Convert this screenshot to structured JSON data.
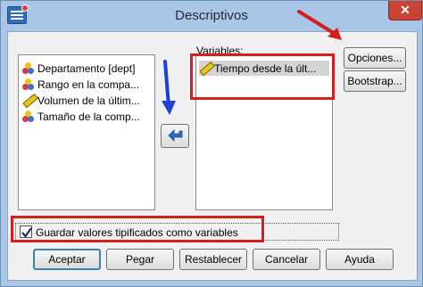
{
  "window": {
    "title": "Descriptivos",
    "close_glyph": "✕"
  },
  "source_list": {
    "items": [
      {
        "label": "Departamento [dept]",
        "icon": "nominal-icon"
      },
      {
        "label": "Rango en la compa...",
        "icon": "nominal-icon"
      },
      {
        "label": "Volumen de la últim...",
        "icon": "scale-icon"
      },
      {
        "label": "Tamaño de la comp...",
        "icon": "nominal-icon"
      }
    ]
  },
  "variables": {
    "label": "Variables:",
    "items": [
      {
        "label": "Tiempo desde la últ...",
        "icon": "scale-icon"
      }
    ]
  },
  "side_buttons": {
    "options": "Opciones...",
    "bootstrap": "Bootstrap..."
  },
  "save_checkbox": {
    "label": "Guardar valores tipificados como variables",
    "checked": true
  },
  "bottom_buttons": {
    "accept": "Aceptar",
    "paste": "Pegar",
    "reset": "Restablecer",
    "cancel": "Cancelar",
    "help": "Ayuda"
  },
  "colors": {
    "annotation_red": "#d41f1f",
    "annotation_blue": "#1e3fd8",
    "frame": "#a9c6e6"
  }
}
